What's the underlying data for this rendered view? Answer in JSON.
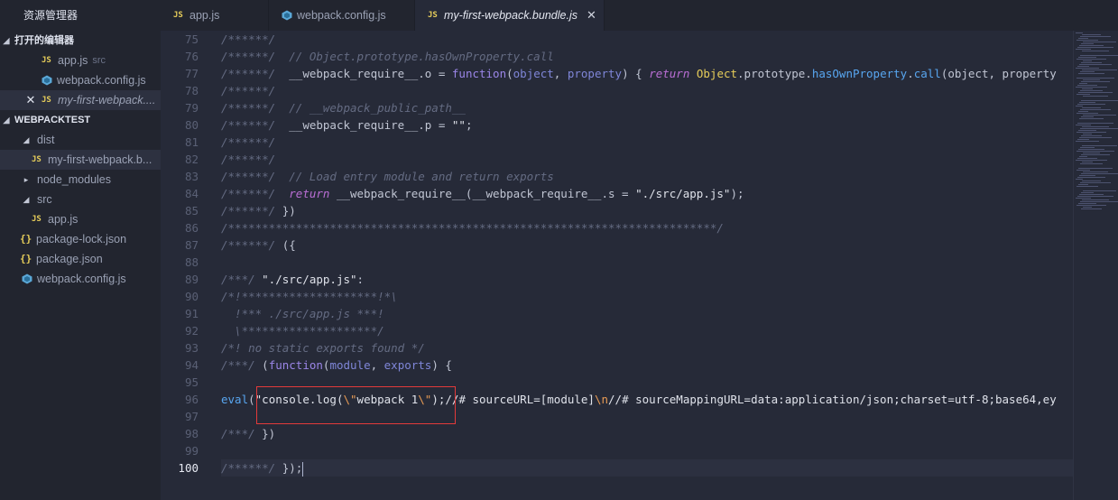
{
  "sidebar": {
    "title": "资源管理器",
    "open_editors_label": "打开的编辑器",
    "open_editors": [
      {
        "name": "app.js",
        "hint": "src"
      },
      {
        "name": "webpack.config.js"
      },
      {
        "name": "my-first-webpack...."
      }
    ],
    "project_label": "WEBPACKTEST",
    "tree": {
      "dist": "dist",
      "bundle": "my-first-webpack.b...",
      "node_modules": "node_modules",
      "src": "src",
      "app": "app.js",
      "package_lock": "package-lock.json",
      "package": "package.json",
      "webpack_config": "webpack.config.js"
    },
    "close_glyph": "✕",
    "js_badge": "JS",
    "json_badge": "{}"
  },
  "tabs": [
    {
      "label": "app.js",
      "icon": "js-file-icon"
    },
    {
      "label": "webpack.config.js",
      "icon": "webpack-cube-icon"
    },
    {
      "label": "my-first-webpack.bundle.js",
      "icon": "js-file-icon",
      "active": true,
      "close": "✕"
    }
  ],
  "editor": {
    "current_line": 100,
    "lines": [
      {
        "n": "75",
        "t": [
          {
            "c": "c",
            "v": "/******/"
          }
        ]
      },
      {
        "n": "76",
        "t": [
          {
            "c": "c",
            "v": "/******/  // Object.prototype.hasOwnProperty.call"
          }
        ]
      },
      {
        "n": "77",
        "t": [
          {
            "c": "c",
            "v": "/******/  "
          },
          {
            "c": "p",
            "v": "__webpack_require__.o = "
          },
          {
            "c": "kw",
            "v": "function"
          },
          {
            "c": "p",
            "v": "("
          },
          {
            "c": "par",
            "v": "object"
          },
          {
            "c": "p",
            "v": ", "
          },
          {
            "c": "par",
            "v": "property"
          },
          {
            "c": "p",
            "v": ") { "
          },
          {
            "c": "kwi",
            "v": "return"
          },
          {
            "c": "p",
            "v": " "
          },
          {
            "c": "obj",
            "v": "Object"
          },
          {
            "c": "p",
            "v": ".prototype."
          },
          {
            "c": "fn",
            "v": "hasOwnProperty"
          },
          {
            "c": "p",
            "v": "."
          },
          {
            "c": "fn",
            "v": "call"
          },
          {
            "c": "p",
            "v": "(object, property"
          }
        ]
      },
      {
        "n": "78",
        "t": [
          {
            "c": "c",
            "v": "/******/"
          }
        ]
      },
      {
        "n": "79",
        "t": [
          {
            "c": "c",
            "v": "/******/  // __webpack_public_path__"
          }
        ]
      },
      {
        "n": "80",
        "t": [
          {
            "c": "c",
            "v": "/******/  "
          },
          {
            "c": "p",
            "v": "__webpack_require__.p = "
          },
          {
            "c": "s",
            "v": "\"\""
          },
          {
            "c": "p",
            "v": ";"
          }
        ]
      },
      {
        "n": "81",
        "t": [
          {
            "c": "c",
            "v": "/******/"
          }
        ]
      },
      {
        "n": "82",
        "t": [
          {
            "c": "c",
            "v": "/******/"
          }
        ]
      },
      {
        "n": "83",
        "t": [
          {
            "c": "c",
            "v": "/******/  // Load entry module and return exports"
          }
        ]
      },
      {
        "n": "84",
        "t": [
          {
            "c": "c",
            "v": "/******/  "
          },
          {
            "c": "kwi",
            "v": "return"
          },
          {
            "c": "p",
            "v": " __webpack_require__(__webpack_require__.s = "
          },
          {
            "c": "s",
            "v": "\"./src/app.js\""
          },
          {
            "c": "p",
            "v": ");"
          }
        ]
      },
      {
        "n": "85",
        "t": [
          {
            "c": "c",
            "v": "/******/ "
          },
          {
            "c": "p",
            "v": "})"
          }
        ]
      },
      {
        "n": "86",
        "t": [
          {
            "c": "c",
            "v": "/************************************************************************/"
          }
        ]
      },
      {
        "n": "87",
        "t": [
          {
            "c": "c",
            "v": "/******/ "
          },
          {
            "c": "p",
            "v": "({"
          }
        ]
      },
      {
        "n": "88",
        "t": []
      },
      {
        "n": "89",
        "t": [
          {
            "c": "c",
            "v": "/***/ "
          },
          {
            "c": "s",
            "v": "\"./src/app.js\""
          },
          {
            "c": "p",
            "v": ":"
          }
        ]
      },
      {
        "n": "90",
        "t": [
          {
            "c": "c",
            "v": "/*!********************!*\\"
          }
        ]
      },
      {
        "n": "91",
        "t": [
          {
            "c": "c",
            "v": "  !*** ./src/app.js ***!"
          }
        ]
      },
      {
        "n": "92",
        "t": [
          {
            "c": "c",
            "v": "  \\********************/"
          }
        ]
      },
      {
        "n": "93",
        "t": [
          {
            "c": "c",
            "v": "/*! no static exports found */"
          }
        ]
      },
      {
        "n": "94",
        "t": [
          {
            "c": "c",
            "v": "/***/ "
          },
          {
            "c": "p",
            "v": "("
          },
          {
            "c": "kw",
            "v": "function"
          },
          {
            "c": "p",
            "v": "("
          },
          {
            "c": "par",
            "v": "module"
          },
          {
            "c": "p",
            "v": ", "
          },
          {
            "c": "par",
            "v": "exports"
          },
          {
            "c": "p",
            "v": ") {"
          }
        ]
      },
      {
        "n": "95",
        "t": []
      },
      {
        "n": "96",
        "t": [
          {
            "c": "fn",
            "v": "eval"
          },
          {
            "c": "p",
            "v": "("
          },
          {
            "c": "s",
            "v": "\"console.log("
          },
          {
            "c": "esc",
            "v": "\\\""
          },
          {
            "c": "s",
            "v": "webpack 1"
          },
          {
            "c": "esc",
            "v": "\\\""
          },
          {
            "c": "s",
            "v": ");//# sourceURL=[module]"
          },
          {
            "c": "esc",
            "v": "\\n"
          },
          {
            "c": "s",
            "v": "//# sourceMappingURL=data:application/json;charset=utf-8;base64,ey"
          }
        ]
      },
      {
        "n": "97",
        "t": []
      },
      {
        "n": "98",
        "t": [
          {
            "c": "c",
            "v": "/***/ "
          },
          {
            "c": "p",
            "v": "})"
          }
        ]
      },
      {
        "n": "99",
        "t": []
      },
      {
        "n": "100",
        "t": [
          {
            "c": "c",
            "v": "/******/ "
          },
          {
            "c": "p",
            "v": "});"
          }
        ]
      }
    ]
  }
}
